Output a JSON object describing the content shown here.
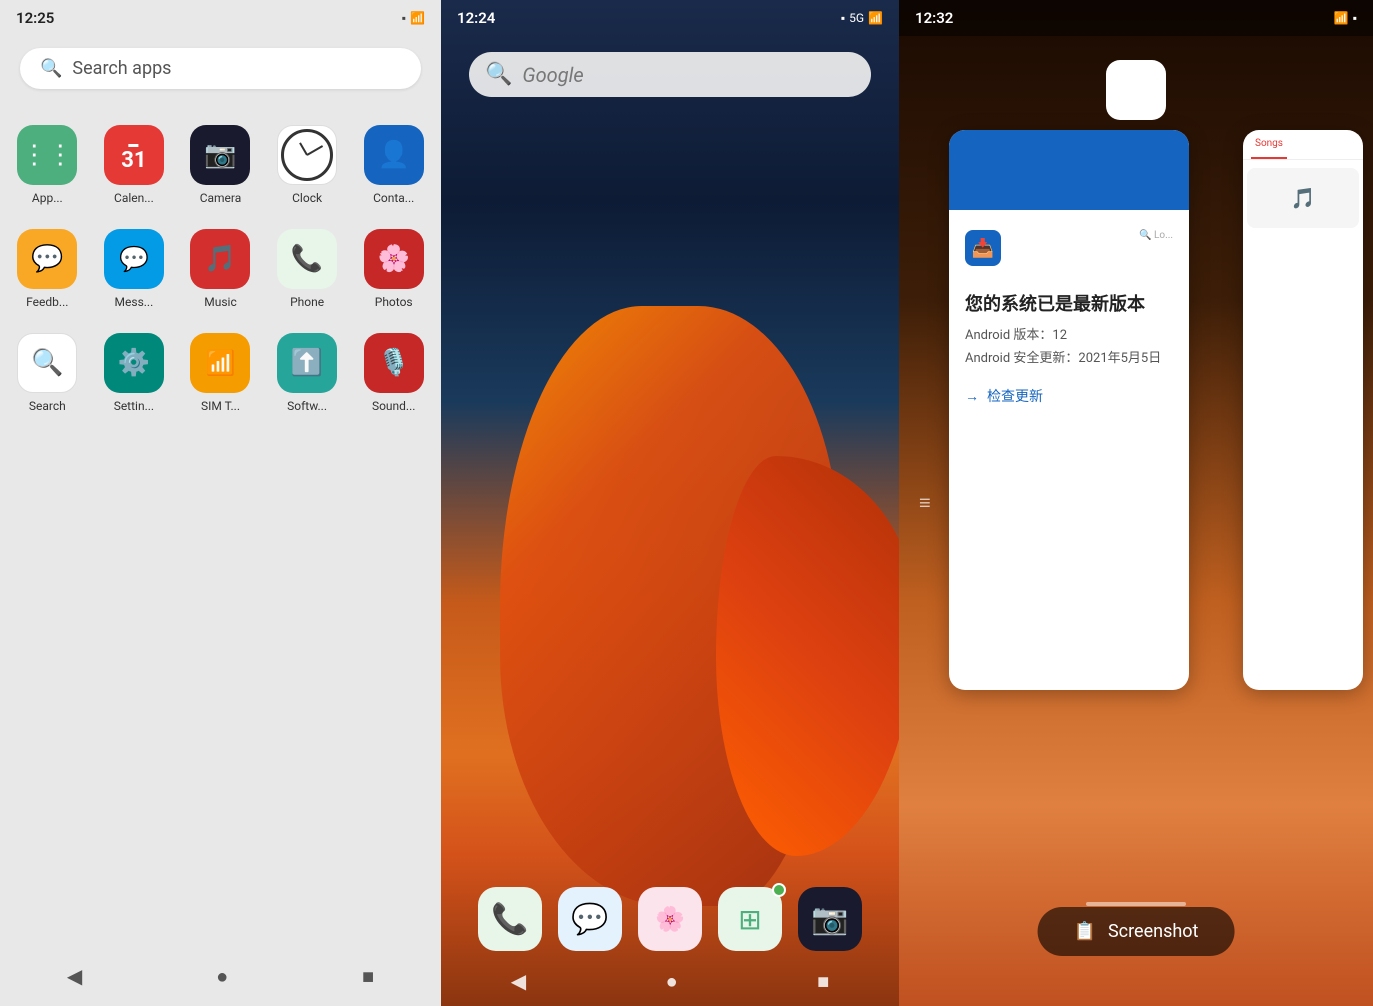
{
  "panel1": {
    "statusTime": "12:25",
    "searchPlaceholder": "Search apps",
    "apps": [
      {
        "name": "App...",
        "icon": "app",
        "color": "green"
      },
      {
        "name": "Calen...",
        "icon": "cal",
        "color": "red"
      },
      {
        "name": "Camera",
        "icon": "cam",
        "color": "dark"
      },
      {
        "name": "Clock",
        "icon": "clock",
        "color": "white"
      },
      {
        "name": "Conta...",
        "icon": "contacts",
        "color": "blue"
      },
      {
        "name": "Feedb...",
        "icon": "feedback",
        "color": "yellow"
      },
      {
        "name": "Mess...",
        "icon": "messages",
        "color": "light-blue"
      },
      {
        "name": "Music",
        "icon": "music",
        "color": "music-red"
      },
      {
        "name": "Phone",
        "icon": "phone",
        "color": "phone-green"
      },
      {
        "name": "Photos",
        "icon": "photos",
        "color": "photos-red"
      },
      {
        "name": "Search",
        "icon": "search",
        "color": "search-white"
      },
      {
        "name": "Settin...",
        "icon": "settings",
        "color": "settings-teal"
      },
      {
        "name": "SIM T...",
        "icon": "sim",
        "color": "sim-yellow"
      },
      {
        "name": "Softw...",
        "icon": "software",
        "color": "software-teal"
      },
      {
        "name": "Sound...",
        "icon": "sound",
        "color": "sound-red"
      }
    ],
    "nav": {
      "back": "◀",
      "home": "●",
      "recents": "■"
    }
  },
  "panel2": {
    "statusTime": "12:24",
    "statusRight": "5G",
    "googleText": "Google",
    "dock": [
      {
        "name": "phone",
        "icon": "📞"
      },
      {
        "name": "messages",
        "icon": "💬"
      },
      {
        "name": "photos",
        "icon": "🌸"
      },
      {
        "name": "apps",
        "icon": "⊞"
      },
      {
        "name": "camera",
        "icon": "📷"
      }
    ],
    "nav": {
      "back": "◀",
      "home": "●",
      "recents": "■"
    }
  },
  "panel3": {
    "statusTime": "12:32",
    "card1": {
      "title": "您的系统已是最新版本",
      "subtitle1": "Android 版本：12",
      "subtitle2": "Android 安全更新：2021年5月5日",
      "link": "检查更新"
    },
    "card2": {
      "tab": "Songs"
    },
    "screenshotLabel": "Screenshot"
  }
}
